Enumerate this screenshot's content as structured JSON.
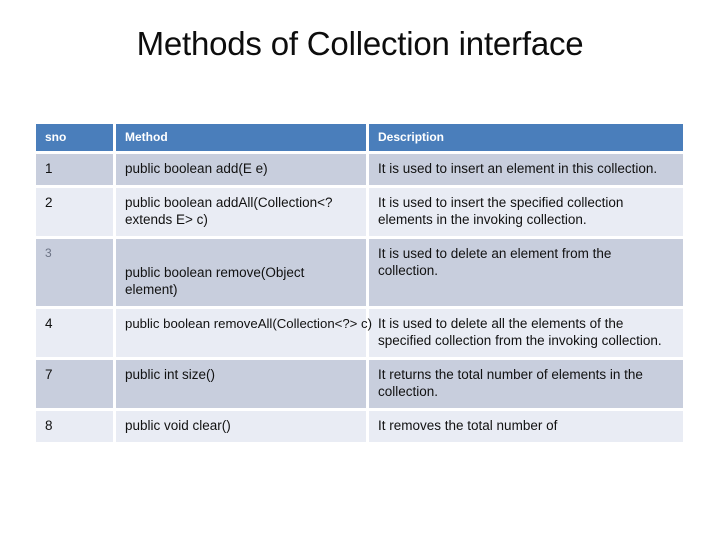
{
  "slide": {
    "title": "Methods of Collection interface",
    "background_color": "#ffffff",
    "title_color": "#0d0d0d"
  },
  "table": {
    "header_bg": "#4a7ebb",
    "header_text_color": "#ffffff",
    "row_band_dark": "#c8cedd",
    "row_band_light": "#e9ecf4",
    "gridline_color": "#ffffff",
    "columns": [
      {
        "key": "sno",
        "label": "sno"
      },
      {
        "key": "method",
        "label": "Method"
      },
      {
        "key": "description",
        "label": "Description"
      }
    ],
    "rows": [
      {
        "sno": "1",
        "method": "public boolean add(E e)",
        "description": "It is used to insert an element in this collection."
      },
      {
        "sno": "2",
        "method": "public boolean addAll(Collection<? extends E> c)",
        "description": "It is used to insert the specified collection elements in the invoking collection."
      },
      {
        "sno": "3",
        "method": "public boolean remove(Object element)",
        "description": "It is used to delete an element from the collection."
      },
      {
        "sno": "4",
        "method": "public boolean removeAll(Collection<?> c)",
        "description": "It is used to delete all the elements of the specified collection from the invoking collection."
      },
      {
        "sno": "7",
        "method": "public int size()",
        "description": "It returns the total number of elements in the collection."
      },
      {
        "sno": "8",
        "method": "public void clear()",
        "description": "It removes the total number of"
      }
    ]
  }
}
